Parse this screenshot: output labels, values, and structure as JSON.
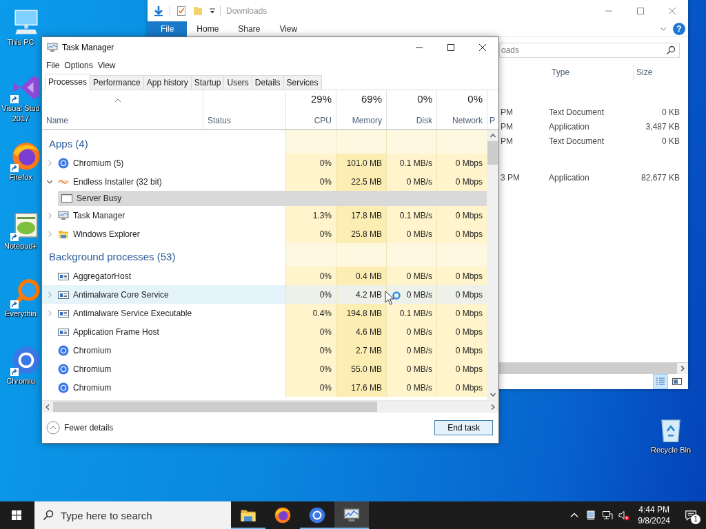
{
  "desktop": {
    "icons": [
      {
        "label": "This PC",
        "kind": "computer",
        "shortcut": false
      },
      {
        "label": "Visual Stud\n2017",
        "kind": "ide",
        "shortcut": true
      },
      {
        "label": "Firefox",
        "kind": "fox",
        "shortcut": true
      },
      {
        "label": "Notepad+",
        "kind": "notepad",
        "shortcut": true
      },
      {
        "label": "Everythin",
        "kind": "magnifier",
        "shortcut": true
      },
      {
        "label": "Chromiu",
        "kind": "browser",
        "shortcut": true
      }
    ],
    "recycle_bin": {
      "label": "Recycle Bin",
      "kind": "recycle"
    }
  },
  "explorer": {
    "title": "Downloads",
    "help": "?",
    "ribbon_tabs": [
      {
        "label": "File",
        "selected": true
      },
      {
        "label": "Home",
        "selected": false
      },
      {
        "label": "Share",
        "selected": false
      },
      {
        "label": "View",
        "selected": false
      }
    ],
    "search": {
      "placeholder": "oads"
    },
    "columns": [
      "Type",
      "Size"
    ],
    "groups": [
      {
        "rows": [
          {
            "date": "PM",
            "type": "Text Document",
            "size": "0 KB"
          },
          {
            "date": "PM",
            "type": "Application",
            "size": "3,487 KB"
          },
          {
            "date": "PM",
            "type": "Text Document",
            "size": "0 KB"
          }
        ]
      },
      {
        "rows": [
          {
            "date": "3 PM",
            "type": "Application",
            "size": "82,677 KB"
          }
        ]
      }
    ]
  },
  "task_manager": {
    "title": "Task Manager",
    "menu": [
      "File",
      "Options",
      "View"
    ],
    "tabs": [
      {
        "label": "Processes",
        "selected": true
      },
      {
        "label": "Performance",
        "selected": false
      },
      {
        "label": "App history",
        "selected": false
      },
      {
        "label": "Startup",
        "selected": false
      },
      {
        "label": "Users",
        "selected": false
      },
      {
        "label": "Details",
        "selected": false
      },
      {
        "label": "Services",
        "selected": false
      }
    ],
    "name_column": "Name",
    "status_column": "Status",
    "metric_columns": [
      {
        "total": "29%",
        "label": "CPU"
      },
      {
        "total": "69%",
        "label": "Memory"
      },
      {
        "total": "0%",
        "label": "Disk"
      },
      {
        "total": "0%",
        "label": "Network"
      }
    ],
    "column_7": "P",
    "groups": [
      {
        "title": "Apps (4)",
        "rows": [
          {
            "name": "Chromium (5)",
            "kind": "browser",
            "expanded": false,
            "selected": false,
            "hovered": false,
            "values": [
              "0%",
              "101.0 MB",
              "0.1 MB/s",
              "0 Mbps"
            ]
          },
          {
            "name": "Endless Installer (32 bit)",
            "kind": "installer",
            "expanded": true,
            "selected": false,
            "hovered": false,
            "values": [
              "0%",
              "22.5 MB",
              "0 MB/s",
              "0 Mbps"
            ],
            "children": [
              {
                "name": "Server Busy",
                "kind": "window",
                "selected": true,
                "hovered": false
              }
            ]
          },
          {
            "name": "Task Manager",
            "kind": "monitor",
            "expanded": false,
            "selected": false,
            "hovered": false,
            "values": [
              "1.3%",
              "17.8 MB",
              "0.1 MB/s",
              "0 Mbps"
            ]
          },
          {
            "name": "Windows Explorer",
            "kind": "folder",
            "expanded": false,
            "selected": false,
            "hovered": false,
            "values": [
              "0%",
              "25.8 MB",
              "0 MB/s",
              "0 Mbps"
            ]
          }
        ]
      },
      {
        "title": "Background processes (53)",
        "rows": [
          {
            "name": "AggregatorHost",
            "kind": "service",
            "selected": false,
            "hovered": false,
            "values": [
              "0%",
              "0.4 MB",
              "0 MB/s",
              "0 Mbps"
            ]
          },
          {
            "name": "Antimalware Core Service",
            "kind": "service",
            "expanded": false,
            "selected": false,
            "hovered": true,
            "values": [
              "0%",
              "4.2 MB",
              "0 MB/s",
              "0 Mbps"
            ]
          },
          {
            "name": "Antimalware Service Executable",
            "kind": "service",
            "expanded": false,
            "selected": false,
            "hovered": false,
            "values": [
              "0.4%",
              "194.8 MB",
              "0.1 MB/s",
              "0 Mbps"
            ]
          },
          {
            "name": "Application Frame Host",
            "kind": "service",
            "selected": false,
            "hovered": false,
            "values": [
              "0%",
              "4.6 MB",
              "0 MB/s",
              "0 Mbps"
            ]
          },
          {
            "name": "Chromium",
            "kind": "browser",
            "selected": false,
            "hovered": false,
            "values": [
              "0%",
              "2.7 MB",
              "0 MB/s",
              "0 Mbps"
            ]
          },
          {
            "name": "Chromium",
            "kind": "browser",
            "selected": false,
            "hovered": false,
            "values": [
              "0%",
              "55.0 MB",
              "0 MB/s",
              "0 Mbps"
            ]
          },
          {
            "name": "Chromium",
            "kind": "browser",
            "selected": false,
            "hovered": false,
            "values": [
              "0%",
              "17.6 MB",
              "0 MB/s",
              "0 Mbps"
            ]
          }
        ]
      }
    ],
    "footer": {
      "fewer_details": "Fewer details",
      "end_task": "End task"
    }
  },
  "taskbar": {
    "search": {
      "placeholder": "Type here to search"
    },
    "apps": [
      {
        "kind": "folder",
        "running": true,
        "selected": false
      },
      {
        "kind": "fox",
        "running": false,
        "selected": false
      },
      {
        "kind": "browser",
        "running": true,
        "selected": false
      },
      {
        "kind": "monitor",
        "running": true,
        "selected": true
      }
    ],
    "time": "4:44 PM",
    "date": "9/8/2024",
    "notifications": "1"
  }
}
